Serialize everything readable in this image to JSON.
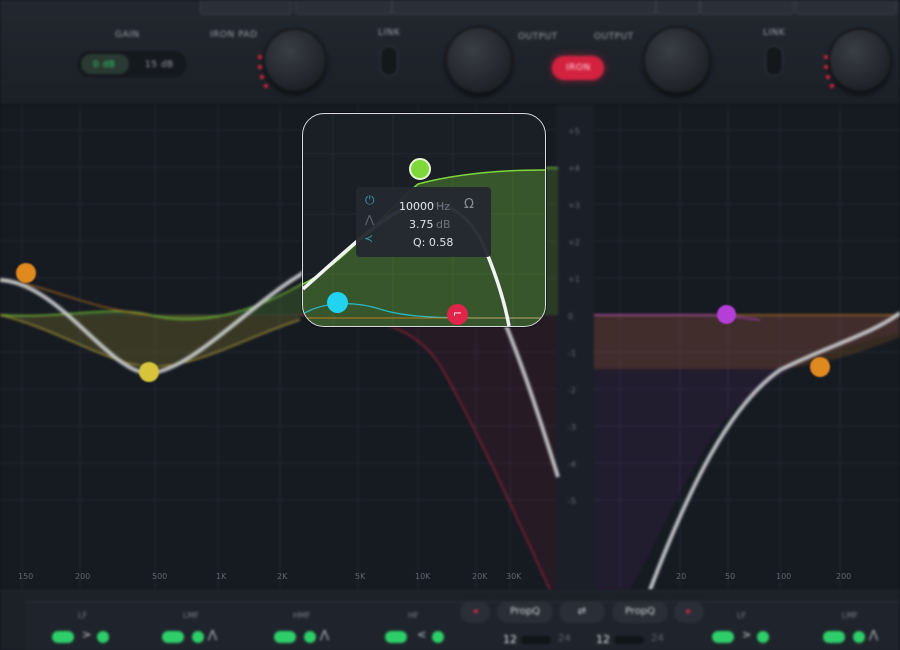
{
  "header": {
    "gain_label": "GAIN",
    "gain_options": [
      "0 dB",
      "15 dB"
    ],
    "iron_pad_label": "IRON PAD",
    "link_label_left": "LINK",
    "output_label_1": "OUTPUT",
    "output_label_2": "OUTPUT",
    "iron_button": "IRON",
    "link_label_right": "LINK"
  },
  "tooltip": {
    "frequency": "10000",
    "frequency_unit": "Hz",
    "gain": "3.75",
    "gain_unit": "dB",
    "q": "Q: 0.58"
  },
  "db_scale": [
    "+5",
    "+4",
    "+3",
    "+2",
    "+1",
    "0",
    "-1",
    "-2",
    "-3",
    "-4",
    "-5"
  ],
  "freq_labels": [
    "150",
    "200",
    "500",
    "1K",
    "2K",
    "5K",
    "10K",
    "20K",
    "30K",
    "20",
    "50",
    "100",
    "200"
  ],
  "bottom": {
    "band_labels": [
      "LF",
      "LMF",
      "HMF",
      "HF",
      "LF",
      "LMF"
    ],
    "prop_q_left": "PropQ",
    "prop_q_right": "PropQ",
    "slope_left_a": "12",
    "slope_left_b": "24",
    "slope_right_a": "12",
    "slope_right_b": "24"
  },
  "colors": {
    "accent_green": "#2ecf6a",
    "band_orange": "#e0891f",
    "band_yellow": "#d8c43a",
    "band_green": "#7fd839",
    "band_cyan": "#22d3f0",
    "band_red": "#e0244a",
    "band_purple": "#b63ed8",
    "iron_red": "#d32240"
  }
}
